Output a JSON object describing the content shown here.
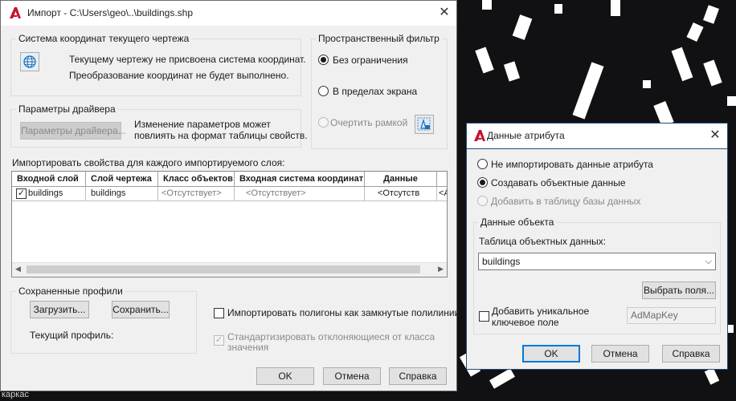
{
  "background": {
    "status_text": "каркас"
  },
  "import_dialog": {
    "title": "Импорт - C:\\Users\\geo\\..\\buildings.shp",
    "coord_system": {
      "group_label": "Система координат текущего чертежа",
      "line1": "Текущему чертежу не присвоена система координат.",
      "line2": "Преобразование координат не будет выполнено."
    },
    "spatial_filter": {
      "group_label": "Пространственный фильтр",
      "option_none": "Без ограничения",
      "option_screen": "В пределах экрана",
      "option_frame": "Очертить рамкой",
      "selected": "option_none"
    },
    "driver": {
      "group_label": "Параметры драйвера",
      "button_label": "Параметры драйвера...",
      "note_line1": "Изменение параметров может",
      "note_line2": "повлиять на формат таблицы свойств."
    },
    "layers_label": "Импортировать свойства для каждого импортируемого слоя:",
    "table": {
      "columns": [
        "Входной слой",
        "Слой чертежа",
        "Класс объектов",
        "Входная система координат",
        "Данные"
      ],
      "rows": [
        {
          "input_layer": "buildings",
          "checked": true,
          "drawing_layer": "buildings",
          "object_class": "<Отсутствует>",
          "input_cs": "<Отсутствует>",
          "data": "<Отсутств",
          "extra": "<А"
        }
      ]
    },
    "profiles": {
      "group_label": "Сохраненные профили",
      "load_label": "Загрузить...",
      "save_label": "Сохранить...",
      "current_label": "Текущий профиль:"
    },
    "import_polygons_label": "Импортировать полигоны как замкнутые полилинии",
    "import_polygons_checked": false,
    "standardize_line1": "Стандартизировать отклоняющиеся от класса",
    "standardize_line2": "значения",
    "standardize_checked": true,
    "ok_label": "OK",
    "cancel_label": "Отмена",
    "help_label": "Справка"
  },
  "attr_dialog": {
    "title": "Данные атрибута",
    "option_none": "Не импортировать данные атрибута",
    "option_create": "Создавать объектные данные",
    "option_add_db": "Добавить в таблицу базы данных",
    "selected": "option_create",
    "object_data": {
      "group_label": "Данные объекта",
      "table_label": "Таблица объектных данных:",
      "table_value": "buildings",
      "select_fields_label": "Выбрать поля...",
      "unique_key_line1": "Добавить уникальное",
      "unique_key_line2": "ключевое поле",
      "unique_key_checked": false,
      "key_field_value": "AdMapKey"
    },
    "ok_label": "OK",
    "cancel_label": "Отмена",
    "help_label": "Справка"
  },
  "colors": {
    "accent": "#0078d7",
    "title_active": "#1f4e79",
    "logo_red": "#c8102e"
  }
}
